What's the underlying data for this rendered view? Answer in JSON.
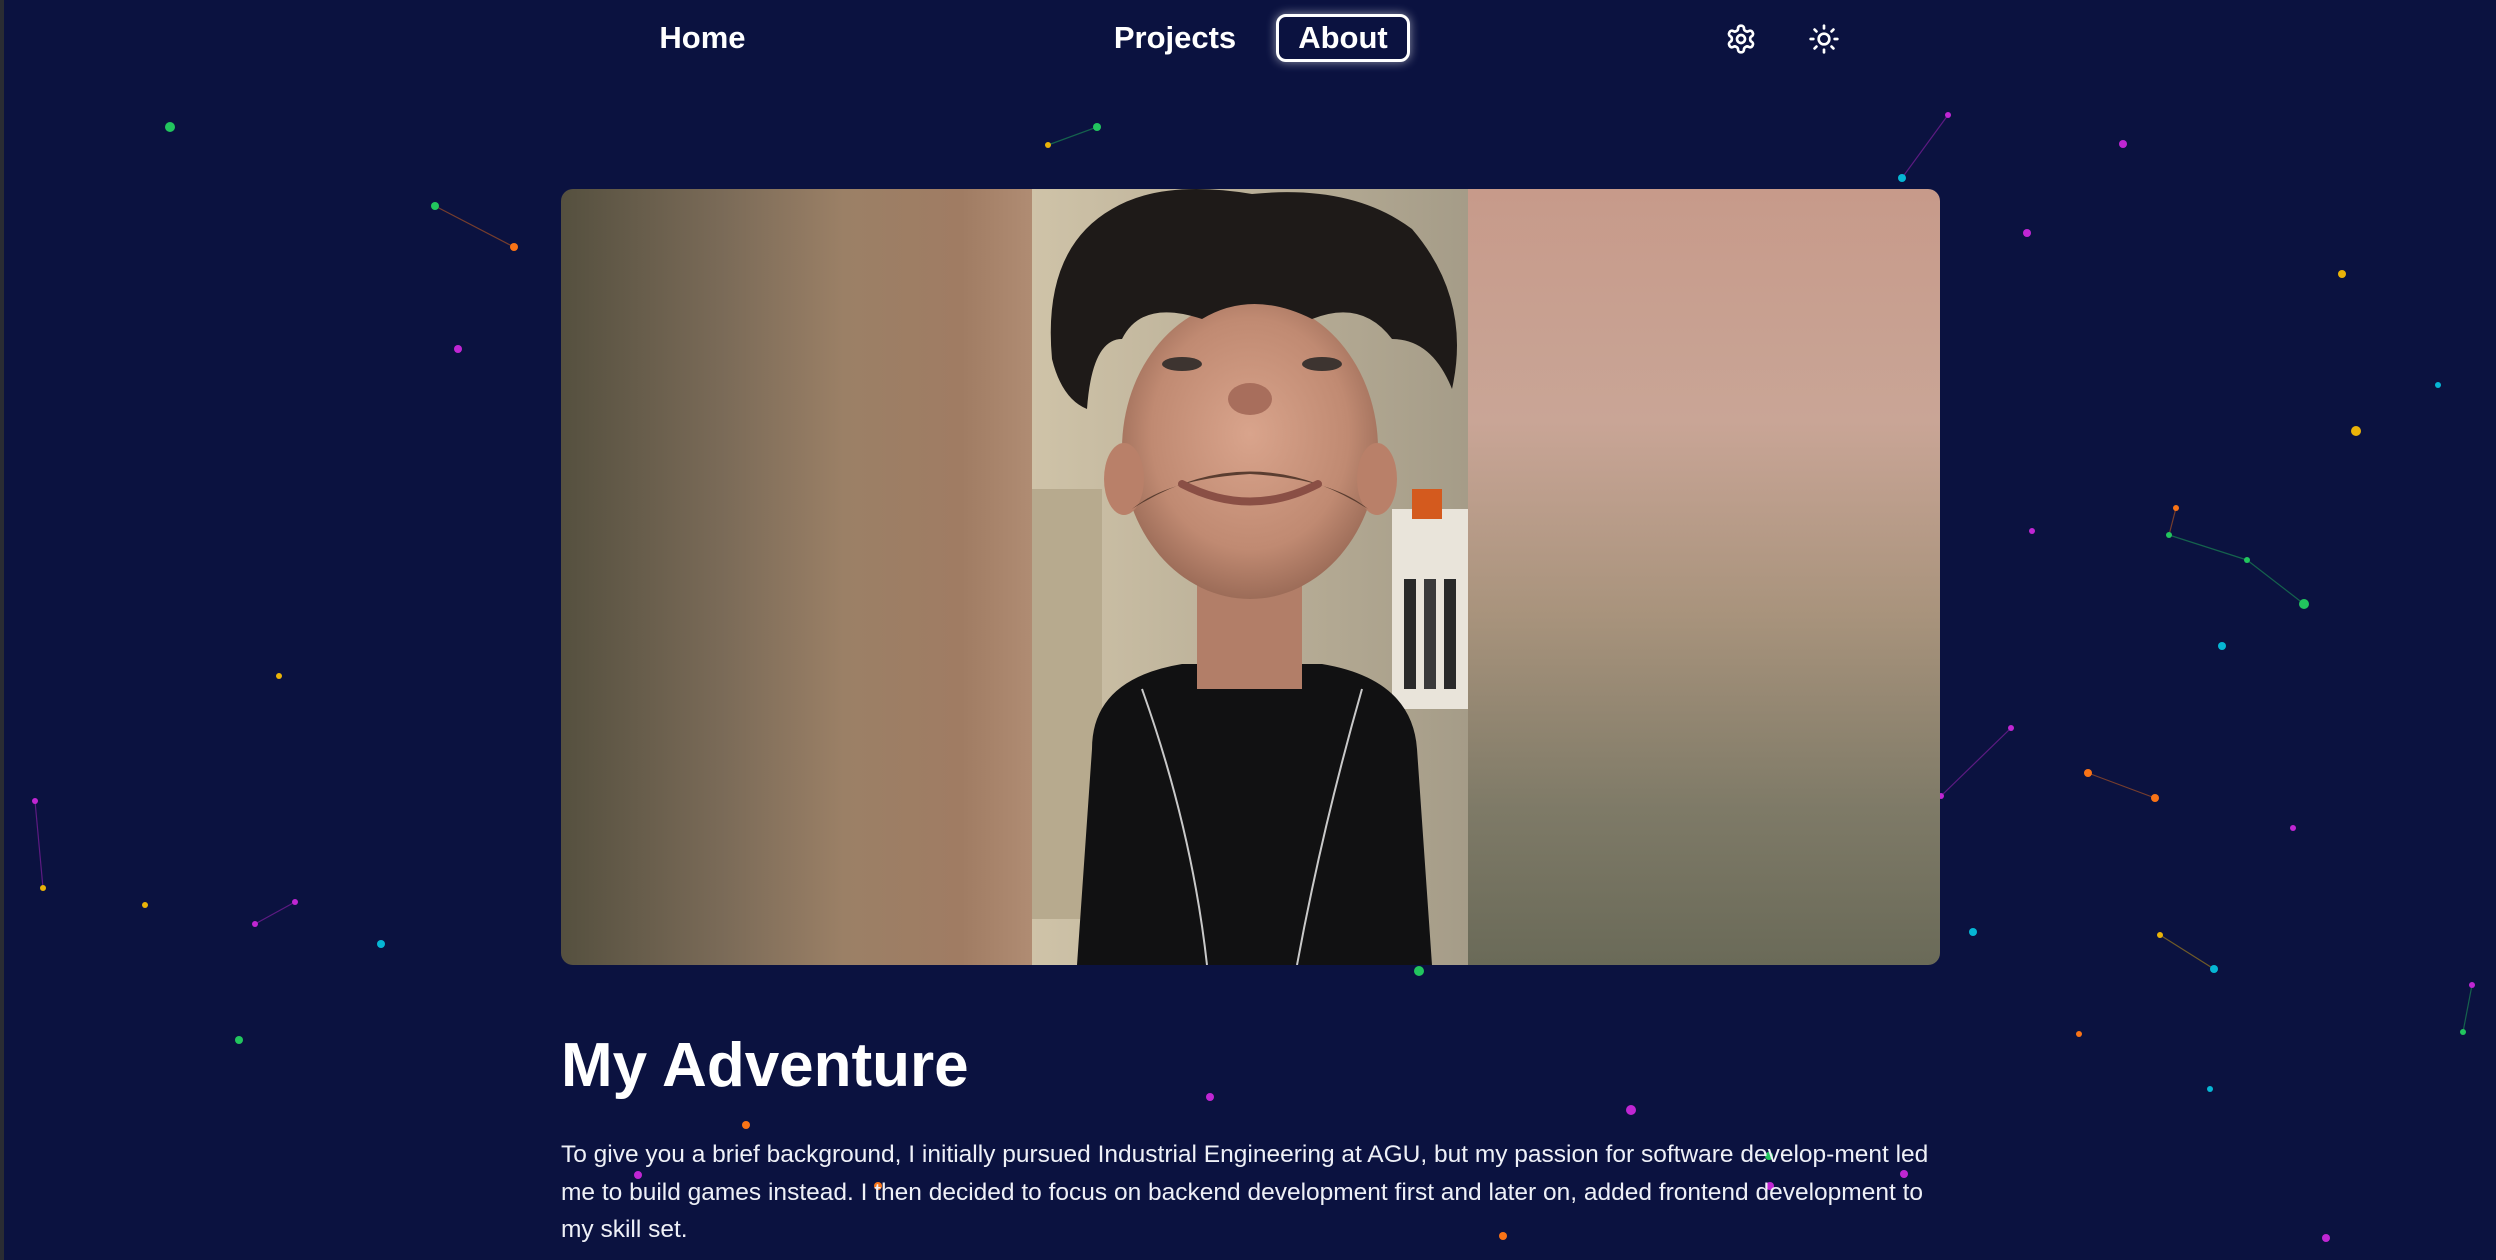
{
  "nav": {
    "home_label": "Home",
    "projects_label": "Projects",
    "about_label": "About",
    "settings_icon": "gear-icon",
    "theme_icon": "sun-icon"
  },
  "hero": {
    "image_subject": "portrait-photo"
  },
  "content": {
    "headline": "My Adventure",
    "bio": "To give you a brief background, I initially pursued Industrial Engineering at AGU, but my passion for software develop-ment led me to build games instead. I then decided to focus on backend development first and later on, added frontend development to my skill set."
  },
  "colors": {
    "background": "#0b1240",
    "text": "#ffffff",
    "particles": [
      "#22c55e",
      "#f97316",
      "#c026d3",
      "#eab308",
      "#06b6d4"
    ]
  }
}
